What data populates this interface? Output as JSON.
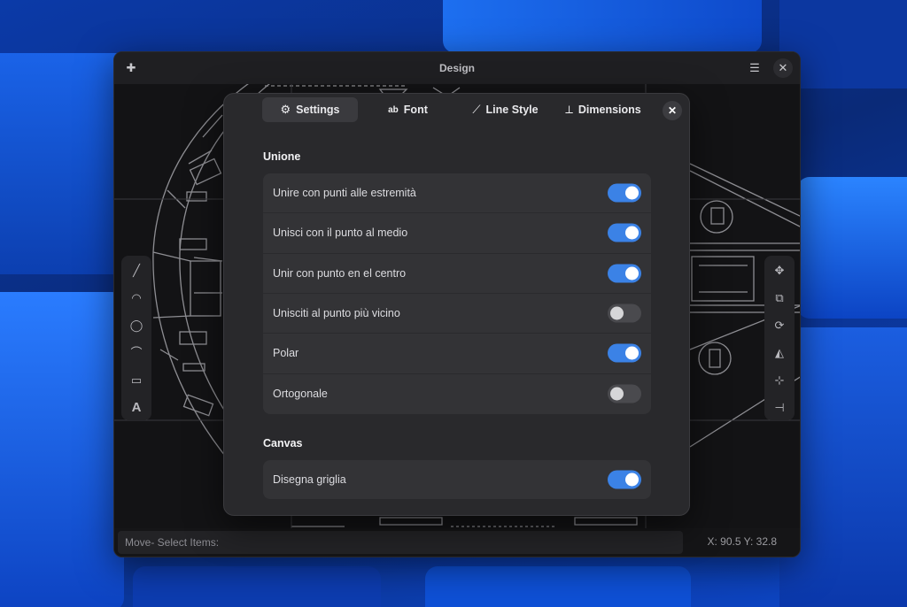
{
  "window": {
    "title": "Design",
    "new_icon": "✚",
    "menu_icon": "☰",
    "close_icon": "✕"
  },
  "left_tools": [
    {
      "name": "line-tool-icon",
      "glyph": "╱"
    },
    {
      "name": "arc-tool-icon",
      "glyph": "◠"
    },
    {
      "name": "circle-tool-icon",
      "glyph": "◯"
    },
    {
      "name": "curve-tool-icon",
      "glyph": "⌒"
    },
    {
      "name": "rectangle-tool-icon",
      "glyph": "▭"
    },
    {
      "name": "text-tool-icon",
      "glyph": "A"
    }
  ],
  "right_tools": [
    {
      "name": "move-tool-icon",
      "glyph": "✥"
    },
    {
      "name": "copy-tool-icon",
      "glyph": "⧉"
    },
    {
      "name": "rotate-tool-icon",
      "glyph": "⟳"
    },
    {
      "name": "mirror-tool-icon",
      "glyph": "◭"
    },
    {
      "name": "trim-tool-icon",
      "glyph": "⊹"
    },
    {
      "name": "extend-tool-icon",
      "glyph": "⊣"
    }
  ],
  "status": {
    "message": "Move- Select Items:",
    "coords": "X: 90.5 Y: 32.8"
  },
  "dialog": {
    "close_icon": "✕",
    "tabs": [
      {
        "label": "Settings",
        "icon": "⚙"
      },
      {
        "label": "Font",
        "icon": "ab"
      },
      {
        "label": "Line Style",
        "icon": "⟋"
      },
      {
        "label": "Dimensions",
        "icon": "⟂"
      }
    ],
    "sections": {
      "union": {
        "title": "Unione",
        "rows": [
          {
            "label": "Unire con punti alle estremità",
            "on": true
          },
          {
            "label": "Unisci con il punto al medio",
            "on": true
          },
          {
            "label": "Unir con punto en el centro",
            "on": true
          },
          {
            "label": "Unisciti al punto più vicino",
            "on": false
          },
          {
            "label": "Polar",
            "on": true
          },
          {
            "label": "Ortogonale",
            "on": false
          }
        ]
      },
      "canvas": {
        "title": "Canvas",
        "rows": [
          {
            "label": "Disegna griglia",
            "on": true
          }
        ]
      }
    }
  },
  "colors": {
    "accent": "#3b82e6",
    "dialog_bg": "#29292c",
    "window_bg": "#141416"
  }
}
